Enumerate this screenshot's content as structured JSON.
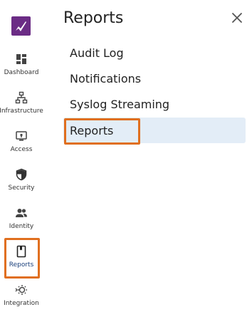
{
  "rail": {
    "items": [
      {
        "label": "Dashboard",
        "icon": "dashboard-icon"
      },
      {
        "label": "Infrastructure",
        "icon": "infrastructure-icon"
      },
      {
        "label": "Access",
        "icon": "access-icon"
      },
      {
        "label": "Security",
        "icon": "shield-icon"
      },
      {
        "label": "Identity",
        "icon": "people-icon"
      },
      {
        "label": "Reports",
        "icon": "reports-icon",
        "active": true
      },
      {
        "label": "Integration",
        "icon": "integration-icon"
      }
    ]
  },
  "panel": {
    "title": "Reports",
    "close_icon": "close-icon",
    "items": [
      {
        "label": "Audit Log"
      },
      {
        "label": "Notifications"
      },
      {
        "label": "Syslog Streaming"
      },
      {
        "label": "Reports",
        "selected": true
      }
    ]
  },
  "colors": {
    "brand": "#6b2c85",
    "highlight_border": "#e06f1f",
    "selected_background": "#e3edf7",
    "active_label": "#1a3f7a"
  }
}
